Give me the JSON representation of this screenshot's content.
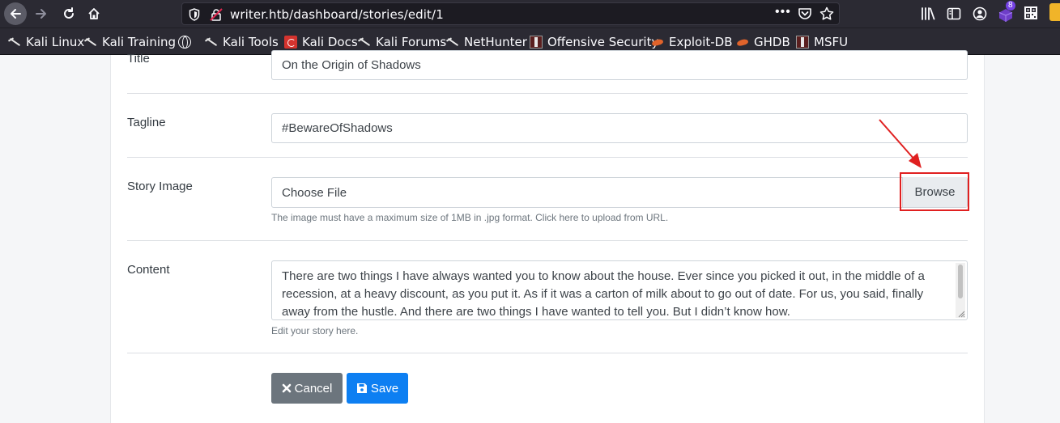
{
  "browser": {
    "url": "writer.htb/dashboard/stories/edit/1",
    "more_label": "•••",
    "extension_badge": "8",
    "bookmarks": [
      {
        "label": "Kali Linux",
        "icon": "kali-dragon-icon"
      },
      {
        "label": "Kali Training",
        "icon": "kali-dragon-icon"
      },
      {
        "label": "",
        "icon": "globe-icon"
      },
      {
        "label": "Kali Tools",
        "icon": "kali-dragon-icon"
      },
      {
        "label": "Kali Docs",
        "icon": "kali-docs-icon"
      },
      {
        "label": "Kali Forums",
        "icon": "kali-dragon-icon"
      },
      {
        "label": "NetHunter",
        "icon": "kali-dragon-icon"
      },
      {
        "label": "Offensive Security",
        "icon": "offsec-icon"
      },
      {
        "label": "Exploit-DB",
        "icon": "exploit-db-icon"
      },
      {
        "label": "GHDB",
        "icon": "exploit-db-icon"
      },
      {
        "label": "MSFU",
        "icon": "offsec-icon"
      }
    ]
  },
  "form": {
    "title": {
      "label": "Title",
      "value": "On the Origin of Shadows"
    },
    "tagline": {
      "label": "Tagline",
      "value": "#BewareOfShadows"
    },
    "story_image": {
      "label": "Story Image",
      "placeholder": "Choose File",
      "browse_label": "Browse",
      "help": "The image must have a maximum size of 1MB in .jpg format. Click here to upload from URL."
    },
    "content": {
      "label": "Content",
      "value": "There are two things I have always wanted you to know about the house. Ever since you picked it out, in the middle of a recession, at a heavy discount, as you put it. As if it was a carton of milk about to go out of date. For us, you said, finally away from the hustle. And there are two things I have wanted to tell you. But I didn’t know how.",
      "help": "Edit your story here."
    },
    "cancel_label": "Cancel",
    "save_label": "Save"
  },
  "colors": {
    "chrome": "#2b2a33",
    "highlight": "#e02020",
    "cancel": "#6c757d",
    "save": "#0d7ff2"
  }
}
